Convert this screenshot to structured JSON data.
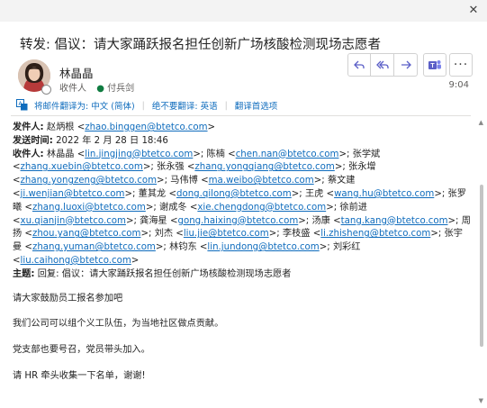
{
  "window": {
    "close_glyph": "✕"
  },
  "message": {
    "subject": "转发: 倡议：请大家踊跃报名担任创新广场核酸检测现场志愿者",
    "sender_display": "林晶晶",
    "recipient_label": "收件人",
    "recipient_name": "付兵剑",
    "time": "9:04"
  },
  "translate": {
    "translate_link": "将邮件翻译为: 中文 (简体)",
    "never_link": "绝不要翻译: 英语",
    "prefs_link": "翻译首选项"
  },
  "actions": {
    "reply": "reply-icon",
    "reply_all": "reply-all-icon",
    "forward": "forward-icon",
    "teams": "teams-icon",
    "more_glyph": "···"
  },
  "header": {
    "from_label": "发件人:",
    "from_name": "赵炳根",
    "from_email": "zhao.binggen@btetco.com",
    "sent_label": "发送时间:",
    "sent_value": "2022 年 2 月 28 日 18:46",
    "to_label": "收件人:",
    "to_list": [
      {
        "name": "林晶晶",
        "email": "lin.jingjing@btetco.com"
      },
      {
        "name": "陈楠",
        "email": "chen.nan@btetco.com"
      },
      {
        "name": "张学斌",
        "email": "zhang.xuebin@btetco.com"
      },
      {
        "name": "张永强",
        "email": "zhang.yongqiang@btetco.com"
      },
      {
        "name": "张永增",
        "email": "zhang.yongzeng@btetco.com"
      },
      {
        "name": "马伟博",
        "email": "ma.weibo@btetco.com"
      },
      {
        "name": "蔡文建",
        "email": "ji.wenjian@btetco.com"
      },
      {
        "name": "董其龙",
        "email": "dong.qilong@btetco.com"
      },
      {
        "name": "王虎",
        "email": "wang.hu@btetco.com"
      },
      {
        "name": "张罗曦",
        "email": "zhang.luoxi@btetco.com"
      },
      {
        "name": "谢成冬",
        "email": "xie.chengdong@btetco.com"
      },
      {
        "name": "徐前进",
        "email": "xu.qianjin@btetco.com"
      },
      {
        "name": "龚海星",
        "email": "gong.haixing@btetco.com"
      },
      {
        "name": "汤康",
        "email": "tang.kang@btetco.com"
      },
      {
        "name": "周扬",
        "email": "zhou.yang@btetco.com"
      },
      {
        "name": "刘杰",
        "email": "liu.jie@btetco.com"
      },
      {
        "name": "李枝盛",
        "email": "li.zhisheng@btetco.com"
      },
      {
        "name": "张宇曼",
        "email": "zhang.yuman@btetco.com"
      },
      {
        "name": "林钧东",
        "email": "lin.jundong@btetco.com"
      },
      {
        "name": "刘彩红",
        "email": "liu.caihong@btetco.com"
      }
    ],
    "subject_label": "主题:",
    "subject_value": "回复: 倡议：请大家踊跃报名担任创新广场核酸检测现场志愿者"
  },
  "body_paragraphs": [
    "请大家鼓励员工报名参加吧",
    "我们公司可以组个义工队伍，为当地社区做点贡献。",
    "党支部也要号召，党员带头加入。",
    "请 HR 牵头收集一下名单，谢谢!"
  ]
}
